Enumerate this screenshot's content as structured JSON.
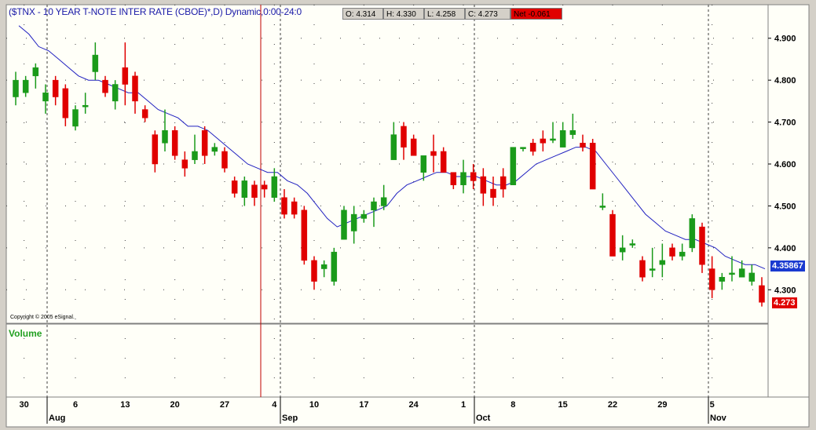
{
  "header": {
    "title": "($TNX - 10 YEAR T-NOTE INTER  RATE (CBOE)*,D) Dynamic,0:00-24:0",
    "open": "O: 4.314",
    "high": "H: 4.330",
    "low": "L: 4.258",
    "close": "C: 4.273",
    "net": "Net -0.061"
  },
  "copyright": "Copyright © 2005 eSignal.",
  "volume_label": "Volume",
  "badges": {
    "ma_value": "4.35867",
    "last_value": "4.273"
  },
  "colors": {
    "up": "#1a9a1a",
    "down": "#e00000",
    "ma_line": "#2020c0",
    "last_badge": "#e00000",
    "ma_badge": "#1a3ad0",
    "cursor": "#c00000"
  },
  "chart_data": {
    "type": "candlestick",
    "title": "($TNX - 10 YEAR T-NOTE INTER  RATE (CBOE)*,D) Dynamic,0:00-24:0",
    "ylim": [
      4.22,
      4.98
    ],
    "yticks": [
      "4.900",
      "4.800",
      "4.700",
      "4.600",
      "4.500",
      "4.400",
      "4.300"
    ],
    "xtick_labels": [
      "30",
      "6",
      "13",
      "20",
      "27",
      "4",
      "10",
      "17",
      "24",
      "1",
      "8",
      "15",
      "22",
      "29",
      "5"
    ],
    "month_labels": [
      "Aug",
      "Sep",
      "Oct",
      "Nov"
    ],
    "grid": true,
    "series": [
      {
        "ohlc": [
          [
            4.76,
            4.82,
            4.74,
            4.8
          ],
          [
            4.77,
            4.81,
            4.76,
            4.8
          ],
          [
            4.81,
            4.84,
            4.78,
            4.83
          ],
          [
            4.75,
            4.79,
            4.72,
            4.77
          ],
          [
            4.8,
            4.81,
            4.74,
            4.76
          ],
          [
            4.78,
            4.79,
            4.69,
            4.71
          ],
          [
            4.69,
            4.74,
            4.68,
            4.73
          ],
          [
            4.74,
            4.77,
            4.72,
            4.74
          ],
          [
            4.82,
            4.89,
            4.8,
            4.86
          ],
          [
            4.8,
            4.81,
            4.76,
            4.77
          ],
          [
            4.75,
            4.8,
            4.73,
            4.79
          ],
          [
            4.83,
            4.89,
            4.74,
            4.79
          ],
          [
            4.81,
            4.82,
            4.72,
            4.75
          ],
          [
            4.73,
            4.74,
            4.7,
            4.71
          ],
          [
            4.67,
            4.68,
            4.58,
            4.6
          ],
          [
            4.65,
            4.73,
            4.63,
            4.68
          ],
          [
            4.68,
            4.69,
            4.61,
            4.62
          ],
          [
            4.61,
            4.63,
            4.57,
            4.59
          ],
          [
            4.61,
            4.67,
            4.6,
            4.63
          ],
          [
            4.68,
            4.69,
            4.6,
            4.62
          ],
          [
            4.63,
            4.65,
            4.62,
            4.64
          ],
          [
            4.63,
            4.64,
            4.58,
            4.59
          ],
          [
            4.56,
            4.57,
            4.52,
            4.53
          ],
          [
            4.52,
            4.57,
            4.5,
            4.56
          ],
          [
            4.55,
            4.56,
            4.5,
            4.52
          ],
          [
            4.55,
            4.56,
            4.52,
            4.54
          ],
          [
            4.52,
            4.59,
            4.51,
            4.57
          ],
          [
            4.52,
            4.54,
            4.47,
            4.48
          ],
          [
            4.51,
            4.52,
            4.47,
            4.48
          ],
          [
            4.49,
            4.5,
            4.36,
            4.37
          ],
          [
            4.37,
            4.38,
            4.3,
            4.32
          ],
          [
            4.35,
            4.37,
            4.33,
            4.36
          ],
          [
            4.32,
            4.4,
            4.31,
            4.39
          ],
          [
            4.42,
            4.5,
            4.42,
            4.49
          ],
          [
            4.44,
            4.5,
            4.41,
            4.48
          ],
          [
            4.47,
            4.49,
            4.46,
            4.48
          ],
          [
            4.49,
            4.52,
            4.45,
            4.51
          ],
          [
            4.5,
            4.55,
            4.49,
            4.52
          ],
          [
            4.61,
            4.7,
            4.61,
            4.67
          ],
          [
            4.69,
            4.7,
            4.61,
            4.64
          ],
          [
            4.66,
            4.67,
            4.62,
            4.62
          ],
          [
            4.58,
            4.61,
            4.56,
            4.62
          ],
          [
            4.63,
            4.67,
            4.58,
            4.62
          ],
          [
            4.63,
            4.64,
            4.58,
            4.58
          ],
          [
            4.58,
            4.58,
            4.54,
            4.55
          ],
          [
            4.55,
            4.61,
            4.53,
            4.58
          ],
          [
            4.58,
            4.6,
            4.54,
            4.56
          ],
          [
            4.57,
            4.59,
            4.5,
            4.53
          ],
          [
            4.54,
            4.57,
            4.5,
            4.52
          ],
          [
            4.57,
            4.59,
            4.52,
            4.54
          ],
          [
            4.55,
            4.64,
            4.55,
            4.64
          ],
          [
            4.64,
            4.64,
            4.63,
            4.64
          ],
          [
            4.65,
            4.66,
            4.62,
            4.63
          ],
          [
            4.66,
            4.68,
            4.63,
            4.65
          ],
          [
            4.66,
            4.7,
            4.65,
            4.66
          ],
          [
            4.64,
            4.7,
            4.64,
            4.68
          ],
          [
            4.67,
            4.72,
            4.66,
            4.68
          ],
          [
            4.65,
            4.67,
            4.63,
            4.64
          ],
          [
            4.65,
            4.66,
            4.54,
            4.54
          ],
          [
            4.5,
            4.53,
            4.49,
            4.5
          ],
          [
            4.48,
            4.49,
            4.38,
            4.38
          ],
          [
            4.39,
            4.43,
            4.37,
            4.4
          ],
          [
            4.41,
            4.42,
            4.4,
            4.41
          ],
          [
            4.37,
            4.38,
            4.32,
            4.33
          ],
          [
            4.35,
            4.4,
            4.33,
            4.35
          ],
          [
            4.36,
            4.41,
            4.33,
            4.37
          ],
          [
            4.4,
            4.41,
            4.37,
            4.38
          ],
          [
            4.38,
            4.41,
            4.37,
            4.39
          ],
          [
            4.4,
            4.48,
            4.39,
            4.47
          ],
          [
            4.45,
            4.46,
            4.34,
            4.36
          ],
          [
            4.35,
            4.38,
            4.28,
            4.3
          ],
          [
            4.32,
            4.34,
            4.3,
            4.33
          ],
          [
            4.34,
            4.38,
            4.32,
            4.34
          ],
          [
            4.33,
            4.37,
            4.33,
            4.35
          ],
          [
            4.32,
            4.36,
            4.31,
            4.34
          ],
          [
            4.31,
            4.33,
            4.26,
            4.27
          ]
        ]
      },
      {
        "type": "line",
        "values": [
          4.93,
          4.91,
          4.88,
          4.87,
          4.85,
          4.83,
          4.81,
          4.8,
          4.8,
          4.79,
          4.78,
          4.77,
          4.77,
          4.75,
          4.73,
          4.72,
          4.71,
          4.69,
          4.69,
          4.68,
          4.66,
          4.64,
          4.62,
          4.6,
          4.59,
          4.58,
          4.58,
          4.56,
          4.55,
          4.53,
          4.5,
          4.47,
          4.45,
          4.46,
          4.47,
          4.48,
          4.49,
          4.5,
          4.53,
          4.55,
          4.56,
          4.57,
          4.58,
          4.58,
          4.57,
          4.57,
          4.57,
          4.56,
          4.55,
          4.55,
          4.56,
          4.58,
          4.6,
          4.61,
          4.62,
          4.63,
          4.64,
          4.64,
          4.63,
          4.6,
          4.57,
          4.54,
          4.51,
          4.48,
          4.46,
          4.44,
          4.43,
          4.42,
          4.42,
          4.41,
          4.4,
          4.38,
          4.37,
          4.36,
          4.36,
          4.35
        ]
      }
    ]
  }
}
